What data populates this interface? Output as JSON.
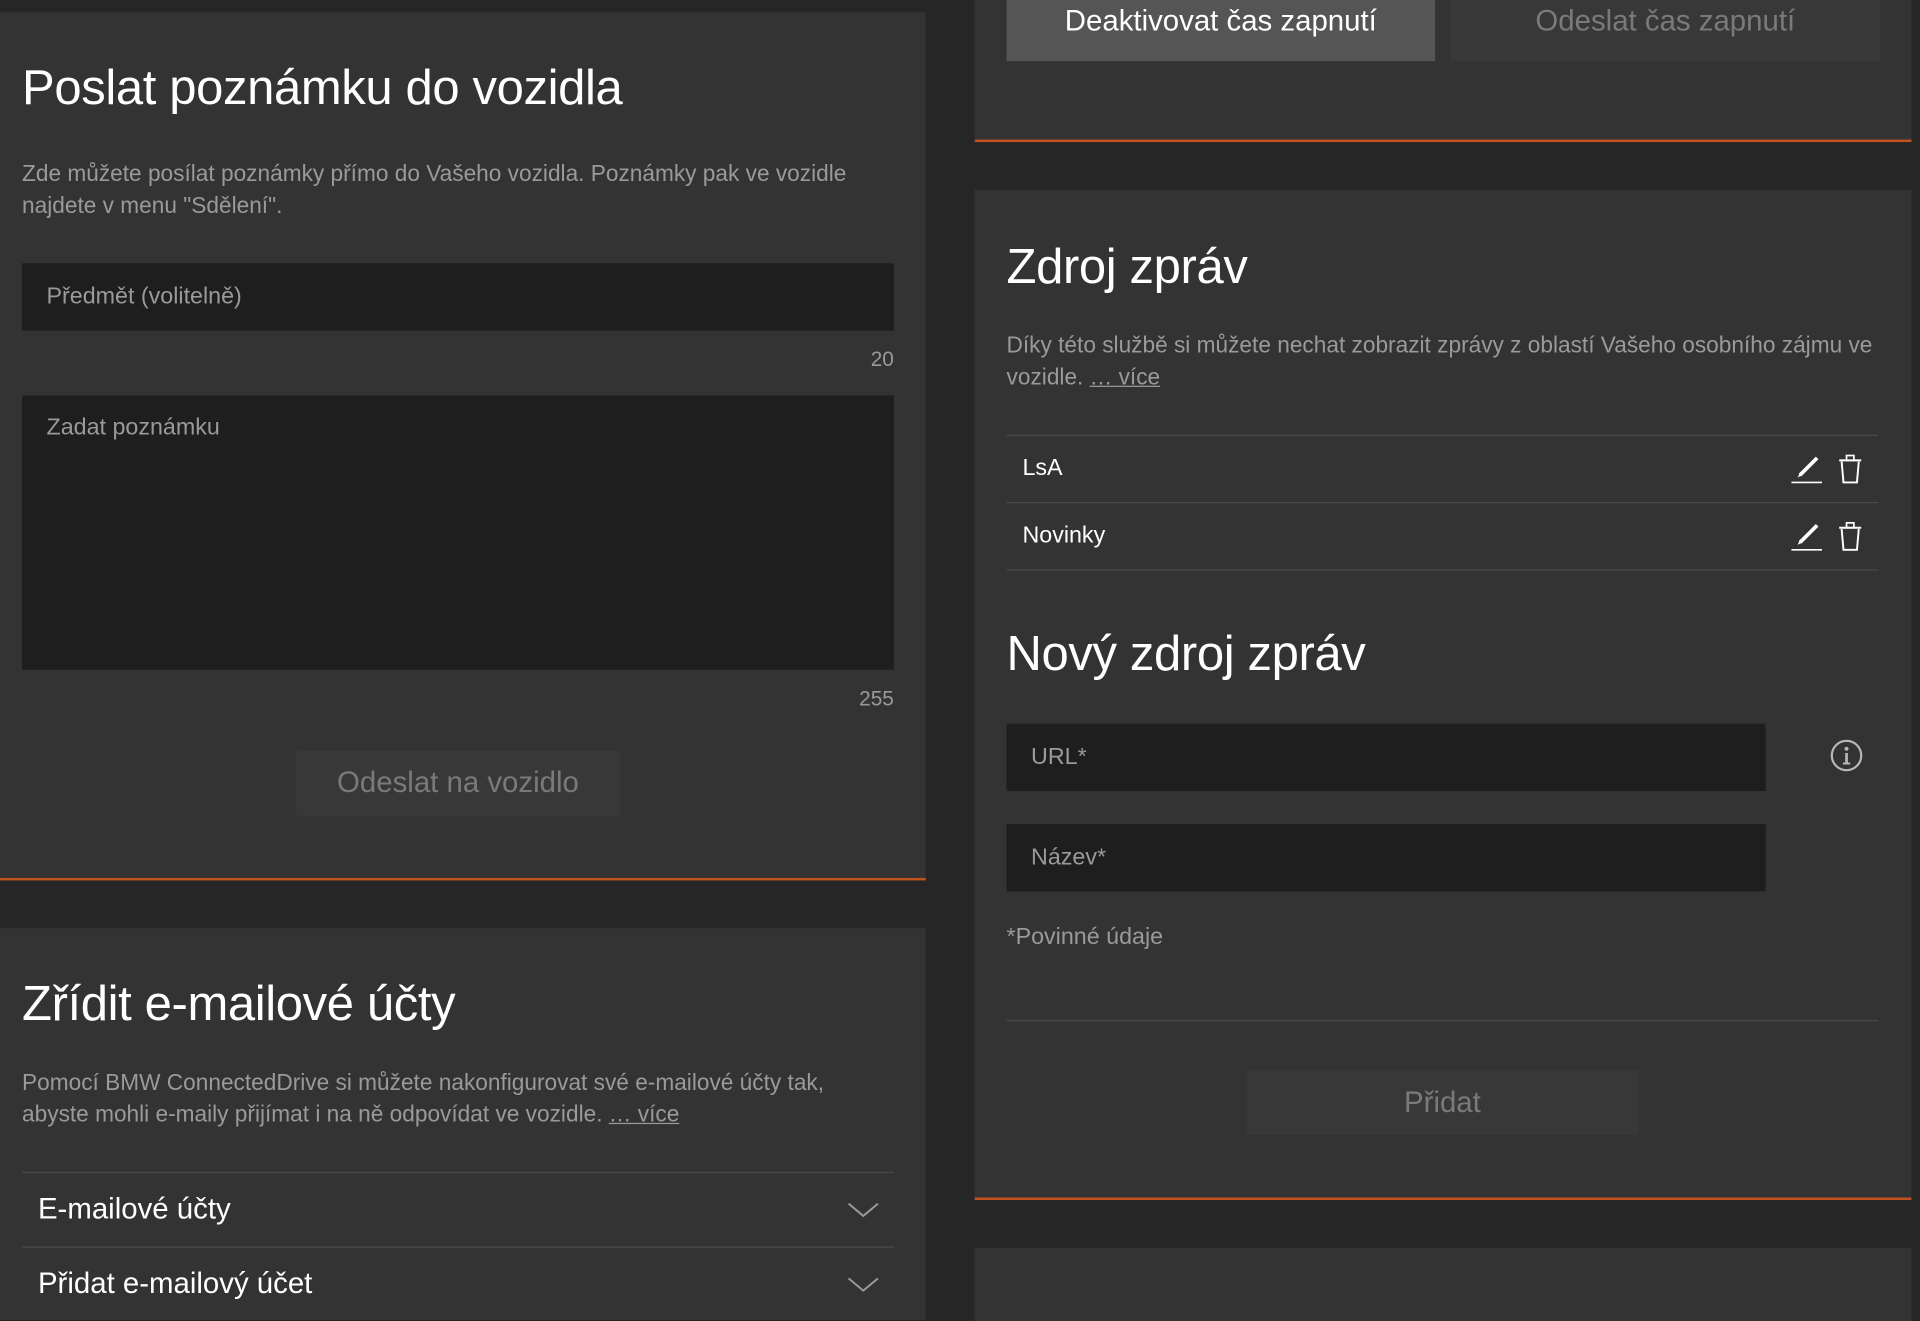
{
  "note": {
    "title": "Poslat poznámku do vozidla",
    "description": "Zde můžete posílat poznámky přímo do Vašeho vozidla. Poznámky pak ve vozidle najdete v menu \"Sdělení\".",
    "subject_placeholder": "Předmět (volitelně)",
    "subject_counter": "20",
    "body_placeholder": "Zadat poznámku",
    "body_counter": "255",
    "send_label": "Odeslat na vozidlo"
  },
  "email": {
    "title": "Zřídit e-mailové účty",
    "description": "Pomocí BMW ConnectedDrive si můžete nakonfigurovat své e-mailové účty tak, abyste mohli e-maily přijímat i na ně odpovídat ve vozidle.",
    "more_link": "… více",
    "accordion": [
      {
        "label": "E-mailové účty"
      },
      {
        "label": "Přidat e-mailový účet"
      }
    ]
  },
  "timer": {
    "deactivate_label": "Deaktivovat čas zapnutí",
    "send_label": "Odeslat čas zapnutí"
  },
  "news": {
    "title": "Zdroj zpráv",
    "description": "Díky této službě si můžete nechat zobrazit zprávy z oblastí Vašeho osobního zájmu ve vozidle.",
    "more_link": "… více",
    "sources": [
      {
        "label": "LsA"
      },
      {
        "label": "Novinky"
      }
    ],
    "new_title": "Nový zdroj zpráv",
    "url_placeholder": "URL*",
    "name_placeholder": "Název*",
    "required_note": "*Povinné údaje",
    "add_label": "Přidat"
  },
  "colors": {
    "accent": "#c2531e",
    "card": "#333333",
    "background": "#262626",
    "field": "#1e1e1e"
  }
}
